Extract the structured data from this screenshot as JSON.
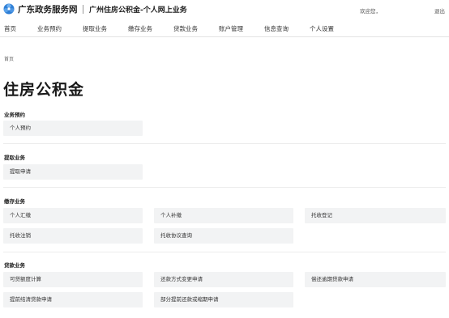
{
  "header": {
    "site_name": "广东政务服务网",
    "sub_title": "广州住房公积金-个人网上业务",
    "welcome": "欢迎您，",
    "logout": "退出"
  },
  "nav": [
    "首页",
    "业务预约",
    "提取业务",
    "缴存业务",
    "贷款业务",
    "账户管理",
    "信息查询",
    "个人设置"
  ],
  "breadcrumb": "首页",
  "page_title": "住房公积金",
  "sections": {
    "appointment": {
      "label": "业务预约",
      "items": [
        "个人预约"
      ]
    },
    "withdraw": {
      "label": "提取业务",
      "items": [
        "提取申请"
      ]
    },
    "deposit": {
      "label": "缴存业务",
      "items": [
        "个人汇缴",
        "个人补缴",
        "托收登记",
        "托收注销",
        "托收协议查询"
      ]
    },
    "loan": {
      "label": "贷款业务",
      "items": [
        "可贷额度计算",
        "还款方式变更申请",
        "偿还逾期贷款申请",
        "提前结清贷款申请",
        "部分提前还款或缩期申请"
      ]
    }
  },
  "colors": {
    "tile_bg": "#f2f3f4",
    "logo_blue": "#2f7fd6"
  }
}
